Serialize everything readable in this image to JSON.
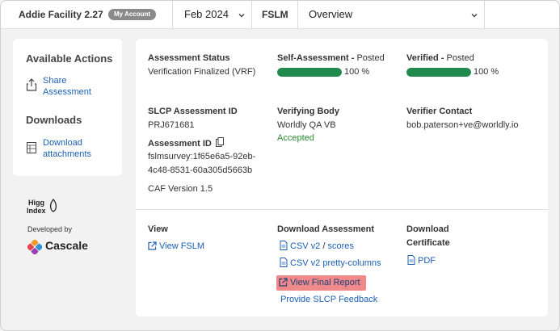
{
  "topbar": {
    "facility": "Addie Facility 2.27",
    "account_badge": "My Account",
    "period": "Feb 2024",
    "module": "FSLM",
    "view": "Overview"
  },
  "sidebar": {
    "actions_title": "Available Actions",
    "share_label": "Share Assessment",
    "downloads_title": "Downloads",
    "download_label": "Download attachments"
  },
  "branding": {
    "higg": "Higg Index",
    "developed_by": "Developed by",
    "cascale": "Cascale"
  },
  "status": {
    "assessment_status_label": "Assessment Status",
    "assessment_status_value": "Verification Finalized (VRF)",
    "self_label": "Self-Assessment",
    "self_state": "Posted",
    "self_progress": 100,
    "self_pct": "100 %",
    "verified_label": "Verified",
    "verified_state": "Posted",
    "verified_progress": 100,
    "verified_pct": "100 %"
  },
  "ids": {
    "slcp_label": "SLCP Assessment ID",
    "slcp_value": "PRJ671681",
    "assessment_id_label": "Assessment ID",
    "assessment_id_line1": "fslmsurvey:1f65e6a5-92eb-",
    "assessment_id_line2": "4c48-8531-60a305d5663b",
    "caf_version": "CAF Version 1.5",
    "verifying_body_label": "Verifying Body",
    "verifying_body_value": "Worldly QA VB",
    "verifying_status": "Accepted",
    "verifier_contact_label": "Verifier Contact",
    "verifier_contact_value": "bob.paterson+ve@worldly.io"
  },
  "bottom": {
    "view_label": "View",
    "view_fslm": "View FSLM",
    "download_assessment_label": "Download Assessment",
    "csv_v2": "CSV v2",
    "csv_sep": "/",
    "scores": "scores",
    "csv_pretty": "CSV v2 pretty-columns",
    "view_final_report": "View Final Report",
    "provide_feedback": "Provide SLCP Feedback",
    "download_certificate_line1": "Download",
    "download_certificate_line2": "Certificate",
    "pdf": "PDF"
  },
  "colors": {
    "link": "#1b5fb3",
    "progress": "#1f8a4c",
    "accepted": "#2e8b3a",
    "highlight": "#f08a8a"
  }
}
